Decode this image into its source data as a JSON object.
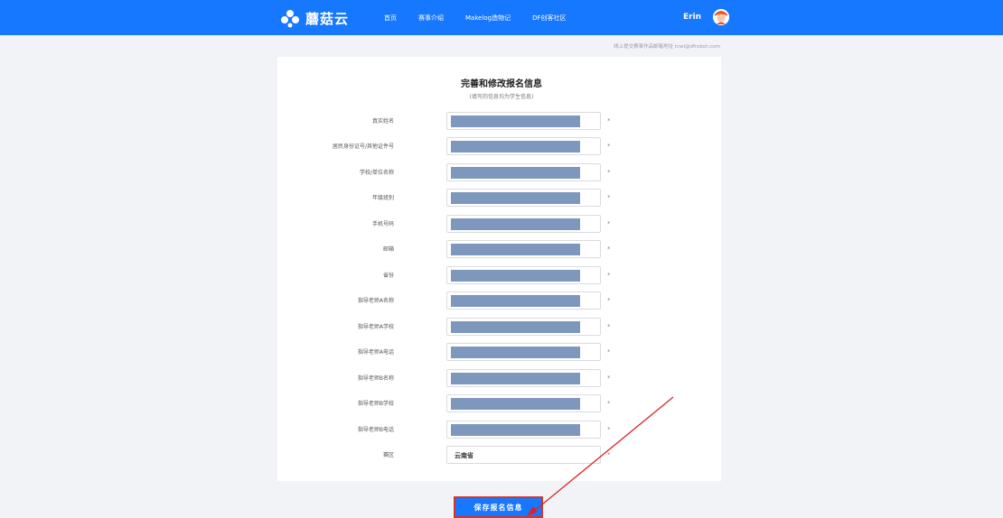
{
  "header": {
    "logo_text": "蘑菇云",
    "nav": [
      "首页",
      "赛事介绍",
      "Makelog造物记",
      "DF创客社区"
    ],
    "user_name": "Erin"
  },
  "notice": "线上提交赛事作品邮箱地址 tcwl@dfrobot.com",
  "form": {
    "title": "完善和修改报名信息",
    "subtitle": "(填写的信息均为学生信息)",
    "required_mark": "*",
    "fields": [
      {
        "label": "真实姓名"
      },
      {
        "label": "居民身份证号/其他证件号"
      },
      {
        "label": "学校/单位名称"
      },
      {
        "label": "年级班别"
      },
      {
        "label": "手机号码"
      },
      {
        "label": "邮箱"
      },
      {
        "label": "省份"
      },
      {
        "label": "指导老师A名称"
      },
      {
        "label": "指导老师A学校"
      },
      {
        "label": "指导老师A电话"
      },
      {
        "label": "指导老师B名称"
      },
      {
        "label": "指导老师B学校"
      },
      {
        "label": "指导老师B电话"
      }
    ],
    "region": {
      "label": "赛区",
      "value": "云南省"
    },
    "save_label": "保存报名信息"
  },
  "colors": {
    "header_bg": "#1677ff",
    "page_bg": "#f2f3f7",
    "redaction": "#7e97bd",
    "annotation_red": "#e02020"
  }
}
